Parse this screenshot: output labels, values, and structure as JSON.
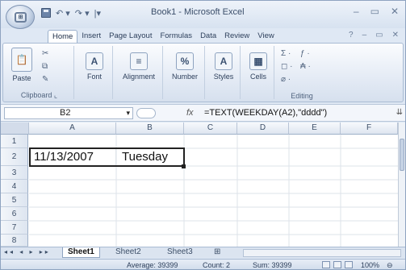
{
  "window": {
    "title": "Book1 - Microsoft Excel",
    "office_button": "office-button",
    "quick_access": [
      "save-icon",
      "undo-icon",
      "redo-icon",
      "customize-icon"
    ],
    "controls": [
      "–",
      "▭",
      "✕"
    ]
  },
  "ribbon": {
    "tabs": [
      "Home",
      "Insert",
      "Page Layout",
      "Formulas",
      "Data",
      "Review",
      "View"
    ],
    "active_tab": "Home",
    "right_controls": [
      "?",
      "–",
      "▭",
      "✕"
    ],
    "groups": {
      "paste_label": "Paste",
      "clipboard_label": "Clipboard",
      "font_label": "Font",
      "alignment_label": "Alignment",
      "number_label": "Number",
      "styles_label": "Styles",
      "cells_label": "Cells",
      "editing_label": "Editing",
      "editing_icons": [
        "Σ ·",
        "ƒ ·",
        "◻ ·",
        "₳ ·",
        "⌀ ·"
      ]
    }
  },
  "formula_bar": {
    "name_box": "B2",
    "fx": "fx",
    "formula": "=TEXT(WEEKDAY(A2),\"dddd\")"
  },
  "sheet": {
    "columns": [
      "A",
      "B",
      "C",
      "D",
      "E",
      "F"
    ],
    "rows": [
      "1",
      "2",
      "3",
      "4",
      "5",
      "6",
      "7",
      "8"
    ],
    "cells": {
      "A2": "11/13/2007",
      "B2": "Tuesday"
    },
    "selected": "B2"
  },
  "sheet_tabs": {
    "nav": "◂◂ ◂ ▸ ▸▸",
    "tabs": [
      "Sheet1",
      "Sheet2",
      "Sheet3"
    ],
    "active": "Sheet1"
  },
  "status_bar": {
    "average": "Average: 39399",
    "count": "Count: 2",
    "sum": "Sum: 39399",
    "zoom": "100%"
  }
}
